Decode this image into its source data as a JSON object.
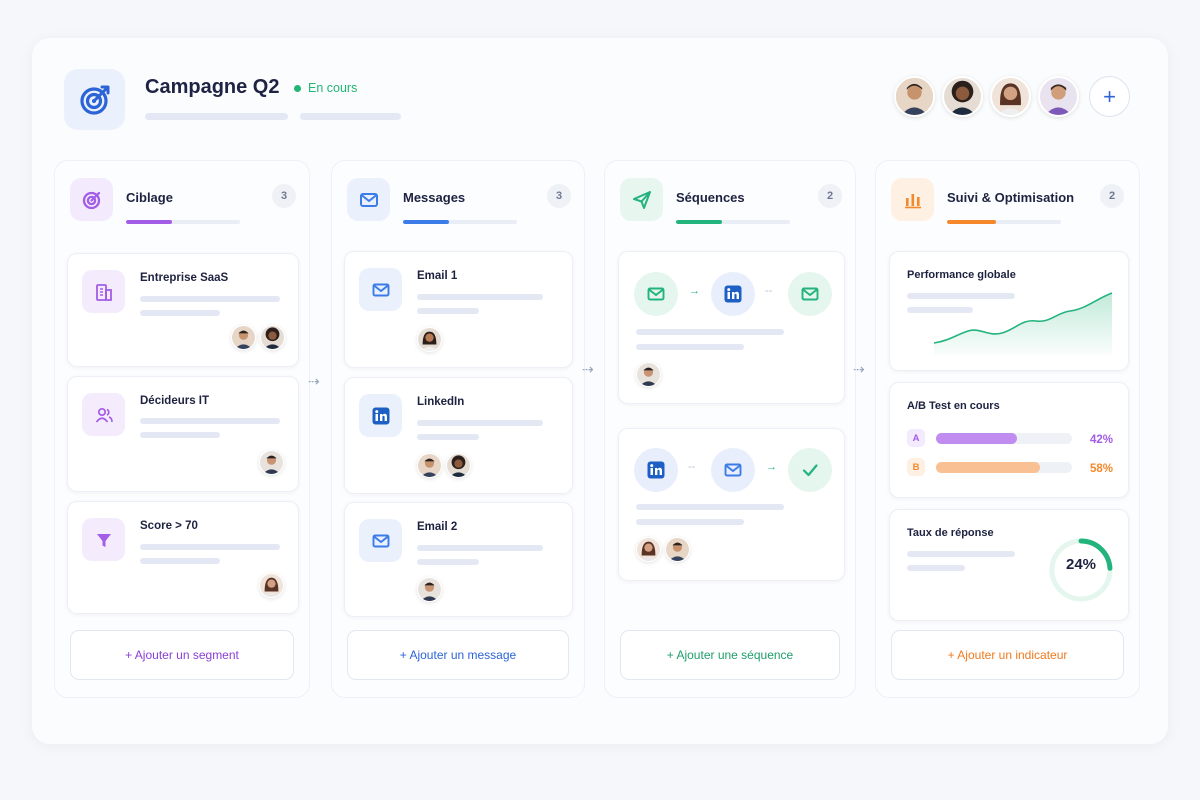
{
  "campaign": {
    "title": "Campagne Q2",
    "status": "En cours"
  },
  "team": {
    "add_label": "+"
  },
  "columns": [
    {
      "title": "Ciblage",
      "count": "3",
      "progress": 0.4,
      "accent": "#a35ce6",
      "add_label": "+ Ajouter un segment",
      "cards": [
        {
          "title": "Entreprise SaaS"
        },
        {
          "title": "Décideurs IT"
        },
        {
          "title": "Score > 70"
        }
      ]
    },
    {
      "title": "Messages",
      "count": "3",
      "progress": 0.4,
      "accent": "#3b7ce8",
      "add_label": "+ Ajouter un message",
      "cards": [
        {
          "title": "Email 1"
        },
        {
          "title": "LinkedIn"
        },
        {
          "title": "Email 2"
        }
      ]
    },
    {
      "title": "Séquences",
      "count": "2",
      "progress": 0.4,
      "accent": "#23b37c",
      "add_label": "+ Ajouter une séquence"
    },
    {
      "title": "Suivi & Optimisation",
      "count": "2",
      "progress": 0.43,
      "accent": "#f5882a",
      "add_label": "+ Ajouter un indicateur"
    }
  ],
  "tracking": {
    "performance": {
      "title": "Performance globale"
    },
    "ab_test": {
      "title": "A/B Test en cours",
      "variants": [
        {
          "label": "A",
          "value": 0.42,
          "pct": "42%",
          "color": "#a35ce6"
        },
        {
          "label": "B",
          "value": 0.58,
          "pct": "58%",
          "color": "#f5882a"
        }
      ]
    },
    "response": {
      "title": "Taux de réponse",
      "value": 0.24,
      "display": "24%"
    }
  },
  "colors": {
    "purple": "#a35ce6",
    "blue": "#3b7ce8",
    "green": "#23b37c",
    "orange": "#f5882a",
    "linkedin": "#1d5fc4"
  }
}
